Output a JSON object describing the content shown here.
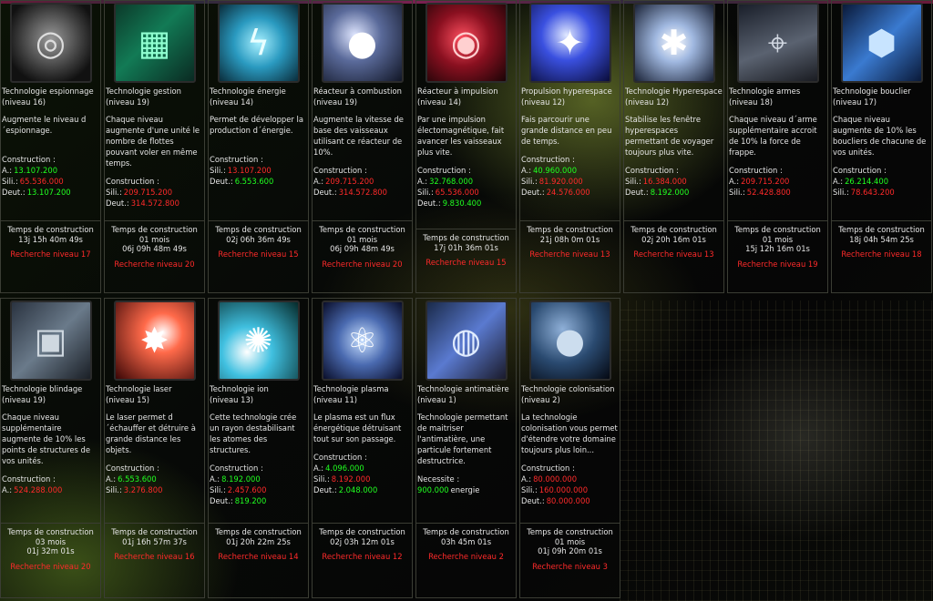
{
  "colors": {
    "sufficient": "#20ff20",
    "insufficient": "#ff2a2a",
    "text": "#e6e6e6",
    "border": "#3b3d34"
  },
  "labels": {
    "construction": "Construction :",
    "time": "Temps de construction",
    "needs": "Necessite :"
  },
  "row1": [
    {
      "name": "Technologie espionnage",
      "level": "(niveau 16)",
      "icon": "spy-scope-icon",
      "desc": "Augmente le niveau d´espionnage.",
      "costs": [
        {
          "k": "A.:",
          "v": "13.107.200",
          "ok": true
        },
        {
          "k": "Sili.:",
          "v": "65.536.000",
          "ok": false
        },
        {
          "k": "Deut.:",
          "v": "13.107.200",
          "ok": true
        }
      ],
      "time": [
        "13j 15h 40m 49s"
      ],
      "action": "Recherche niveau 17"
    },
    {
      "name": "Technologie gestion",
      "level": "(niveau 19)",
      "icon": "computer-grid-icon",
      "desc": "Chaque niveau augmente d'une unité le nombre de flottes pouvant voler en même temps.",
      "costs": [
        {
          "k": "Sili.:",
          "v": "209.715.200",
          "ok": false
        },
        {
          "k": "Deut.:",
          "v": "314.572.800",
          "ok": false
        }
      ],
      "time": [
        "01 mois",
        "06j 09h 48m 49s"
      ],
      "action": "Recherche niveau 20"
    },
    {
      "name": "Technologie énergie",
      "level": "(niveau 14)",
      "icon": "energy-reactor-icon",
      "desc": "Permet de développer la production d´énergie.",
      "costs": [
        {
          "k": "Sili.:",
          "v": "13.107.200",
          "ok": false
        },
        {
          "k": "Deut.:",
          "v": "6.553.600",
          "ok": true
        }
      ],
      "time": [
        "02j 06h 36m 49s"
      ],
      "action": "Recherche niveau 15"
    },
    {
      "name": "Réacteur à combustion",
      "level": "(niveau 19)",
      "icon": "combustion-engine-icon",
      "desc": "Augmente la vitesse de base des vaisseaux utilisant ce réacteur de 10%.",
      "costs": [
        {
          "k": "A.:",
          "v": "209.715.200",
          "ok": false
        },
        {
          "k": "Deut.:",
          "v": "314.572.800",
          "ok": false
        }
      ],
      "time": [
        "01 mois",
        "06j 09h 48m 49s"
      ],
      "action": "Recherche niveau 20"
    },
    {
      "name": "Réacteur à impulsion",
      "level": "(niveau 14)",
      "icon": "impulse-engine-icon",
      "desc": "Par une impulsion électomagnétique, fait avancer les vaisseaux plus vite.",
      "costs": [
        {
          "k": "A.:",
          "v": "32.768.000",
          "ok": true
        },
        {
          "k": "Sili.:",
          "v": "65.536.000",
          "ok": false
        },
        {
          "k": "Deut.:",
          "v": "9.830.400",
          "ok": true
        }
      ],
      "time": [
        "17j 01h 36m 01s"
      ],
      "action": "Recherche niveau 15"
    },
    {
      "name": "Propulsion hyperespace",
      "level": "(niveau 12)",
      "icon": "hyperspace-drive-icon",
      "desc": "Fais parcourir une grande distance en peu de temps.",
      "costs": [
        {
          "k": "A.:",
          "v": "40.960.000",
          "ok": true
        },
        {
          "k": "Sili.:",
          "v": "81.920.000",
          "ok": false
        },
        {
          "k": "Deut.:",
          "v": "24.576.000",
          "ok": false
        }
      ],
      "time": [
        "21j 08h 0m 01s"
      ],
      "action": "Recherche niveau 13"
    },
    {
      "name": "Technologie Hyperespace",
      "level": "(niveau 12)",
      "icon": "hyperspace-tech-icon",
      "desc": "Stabilise les fenêtre hyperespaces permettant de voyager toujours plus vite.",
      "costs": [
        {
          "k": "Sili.:",
          "v": "16.384.000",
          "ok": false
        },
        {
          "k": "Deut.:",
          "v": "8.192.000",
          "ok": true
        }
      ],
      "time": [
        "02j 20h 16m 01s"
      ],
      "action": "Recherche niveau 13"
    },
    {
      "name": "Technologie armes",
      "level": "(niveau 18)",
      "icon": "weapon-turret-icon",
      "desc": "Chaque niveau d´arme supplémentaire accroit de 10% la force de frappe.",
      "costs": [
        {
          "k": "A.:",
          "v": "209.715.200",
          "ok": false
        },
        {
          "k": "Sili.:",
          "v": "52.428.800",
          "ok": false
        }
      ],
      "time": [
        "01 mois",
        "15j 12h 16m 01s"
      ],
      "action": "Recherche niveau 19"
    },
    {
      "name": "Technologie bouclier",
      "level": "(niveau 17)",
      "icon": "shield-beam-icon",
      "desc": "Chaque niveau augmente de 10% les boucliers de chacune de vos unités.",
      "costs": [
        {
          "k": "A.:",
          "v": "26.214.400",
          "ok": true
        },
        {
          "k": "Sili.:",
          "v": "78.643.200",
          "ok": false
        }
      ],
      "time": [
        "18j 04h 54m 25s"
      ],
      "action": "Recherche niveau 18"
    }
  ],
  "row2": [
    {
      "name": "Technologie blindage",
      "level": "(niveau 19)",
      "icon": "armor-plating-icon",
      "desc": "Chaque niveau supplémentaire augmente de 10% les points de structures de vos unités.",
      "costs": [
        {
          "k": "A.:",
          "v": "524.288.000",
          "ok": false
        }
      ],
      "time": [
        "03 mois",
        "01j 32m 01s"
      ],
      "action": "Recherche niveau 20"
    },
    {
      "name": "Technologie laser",
      "level": "(niveau 15)",
      "icon": "laser-beam-icon",
      "desc": "Le laser permet d´échauffer et détruire à grande distance les objets.",
      "costs": [
        {
          "k": "A.:",
          "v": "6.553.600",
          "ok": true
        },
        {
          "k": "Sili.:",
          "v": "3.276.800",
          "ok": false
        }
      ],
      "time": [
        "01j 16h 57m 37s"
      ],
      "action": "Recherche niveau 16"
    },
    {
      "name": "Technologie ion",
      "level": "(niveau 13)",
      "icon": "ion-cannon-icon",
      "desc": "Cette technologie crée un rayon destabilisant les atomes des structures.",
      "costs": [
        {
          "k": "A.:",
          "v": "8.192.000",
          "ok": true
        },
        {
          "k": "Sili.:",
          "v": "2.457.600",
          "ok": false
        },
        {
          "k": "Deut.:",
          "v": "819.200",
          "ok": true
        }
      ],
      "time": [
        "01j 20h 22m 25s"
      ],
      "action": "Recherche niveau 14"
    },
    {
      "name": "Technologie plasma",
      "level": "(niveau 11)",
      "icon": "plasma-orb-icon",
      "desc": "Le plasma est un flux énergétique détruisant tout sur son passage.",
      "costs": [
        {
          "k": "A.:",
          "v": "4.096.000",
          "ok": true
        },
        {
          "k": "Sili.:",
          "v": "8.192.000",
          "ok": false
        },
        {
          "k": "Deut.:",
          "v": "2.048.000",
          "ok": true
        }
      ],
      "time": [
        "02j 03h 12m 01s"
      ],
      "action": "Recherche niveau 12"
    },
    {
      "name": "Technologie antimatière",
      "level": "(niveau 1)",
      "icon": "antimatter-chamber-icon",
      "desc": "Technologie permettant de maitriser l'antimatière, une particule fortement destructrice.",
      "needs": true,
      "costs": [
        {
          "k": "900.000",
          "v": "energie",
          "ok": true,
          "swap": true
        }
      ],
      "time": [
        "03h 45m 01s"
      ],
      "action": "Recherche niveau 2"
    },
    {
      "name": "Technologie colonisation",
      "level": "(niveau 2)",
      "icon": "colony-planet-icon",
      "desc": "La technologie colonisation vous permet d'étendre votre domaine toujours plus loin...",
      "costs": [
        {
          "k": "A.:",
          "v": "80.000.000",
          "ok": false
        },
        {
          "k": "Sili.:",
          "v": "160.000.000",
          "ok": false
        },
        {
          "k": "Deut.:",
          "v": "80.000.000",
          "ok": false
        }
      ],
      "time": [
        "01 mois",
        "01j 09h 20m 01s"
      ],
      "action": "Recherche niveau 3"
    }
  ]
}
